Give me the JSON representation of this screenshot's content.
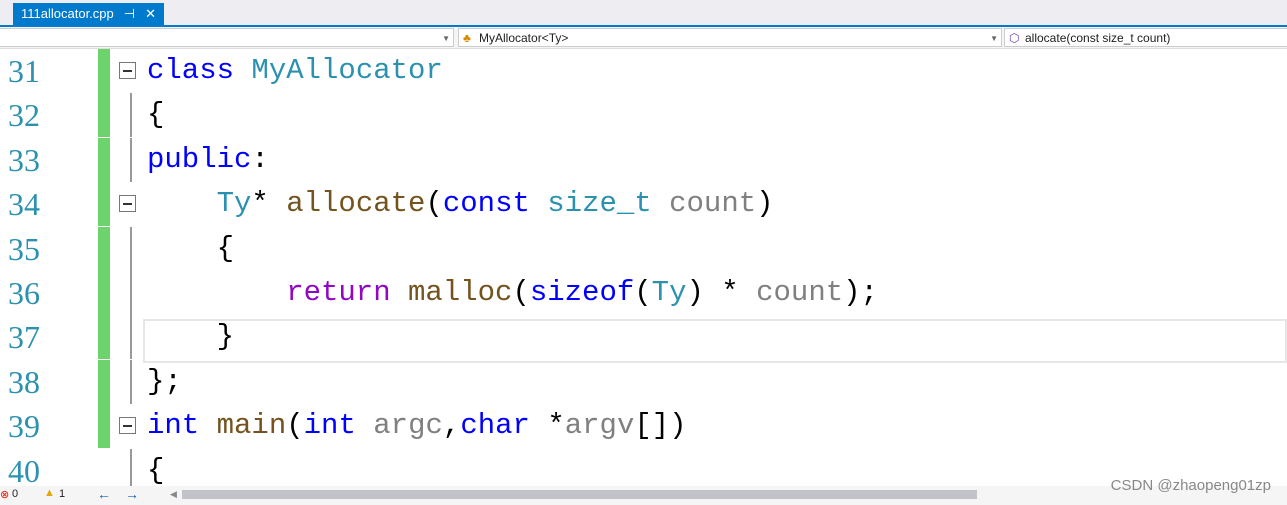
{
  "tab": {
    "filename": "111allocator.cpp",
    "pin": "⊣",
    "close": "✕"
  },
  "nav": {
    "scope": "",
    "class": "MyAllocator<Ty>",
    "member": "allocate(const size_t count)"
  },
  "lines": [
    {
      "n": "31",
      "t": [
        [
          "kw",
          "class "
        ],
        [
          "ty",
          "MyAllocator"
        ]
      ],
      "indent": 0
    },
    {
      "n": "32",
      "t": [
        [
          "",
          "{"
        ]
      ],
      "indent": 0
    },
    {
      "n": "33",
      "t": [
        [
          "kw",
          "public"
        ],
        [
          "",
          ":"
        ]
      ],
      "indent": 0
    },
    {
      "n": "34",
      "t": [
        [
          "ty",
          "Ty"
        ],
        [
          "",
          "* "
        ],
        [
          "fn",
          "allocate"
        ],
        [
          "",
          "("
        ],
        [
          "kw",
          "const "
        ],
        [
          "ty",
          "size_t "
        ],
        [
          "pm",
          "count"
        ],
        [
          "",
          ")"
        ]
      ],
      "indent": 4
    },
    {
      "n": "35",
      "t": [
        [
          "",
          "{"
        ]
      ],
      "indent": 4
    },
    {
      "n": "36",
      "t": [
        [
          "rt",
          "return "
        ],
        [
          "fn",
          "malloc"
        ],
        [
          "",
          "("
        ],
        [
          "kw",
          "sizeof"
        ],
        [
          "",
          "("
        ],
        [
          "ty",
          "Ty"
        ],
        [
          "",
          ") * "
        ],
        [
          "pm",
          "count"
        ],
        [
          "",
          ");"
        ]
      ],
      "indent": 8
    },
    {
      "n": "37",
      "t": [
        [
          "",
          "}"
        ]
      ],
      "indent": 4
    },
    {
      "n": "38",
      "t": [
        [
          "",
          "};"
        ]
      ],
      "indent": 0
    },
    {
      "n": "39",
      "t": [
        [
          "kw",
          "int "
        ],
        [
          "fn",
          "main"
        ],
        [
          "",
          "("
        ],
        [
          "kw",
          "int "
        ],
        [
          "pm",
          "argc"
        ],
        [
          "",
          ","
        ],
        [
          "kw",
          "char "
        ],
        [
          "",
          "*"
        ],
        [
          "pm",
          "argv"
        ],
        [
          "",
          "[])"
        ]
      ],
      "indent": 0
    },
    {
      "n": "40",
      "t": [
        [
          "",
          "{"
        ]
      ],
      "indent": 0
    }
  ],
  "status": {
    "errors": "0",
    "warnings": "1"
  },
  "watermark": "CSDN @zhaopeng01zp"
}
